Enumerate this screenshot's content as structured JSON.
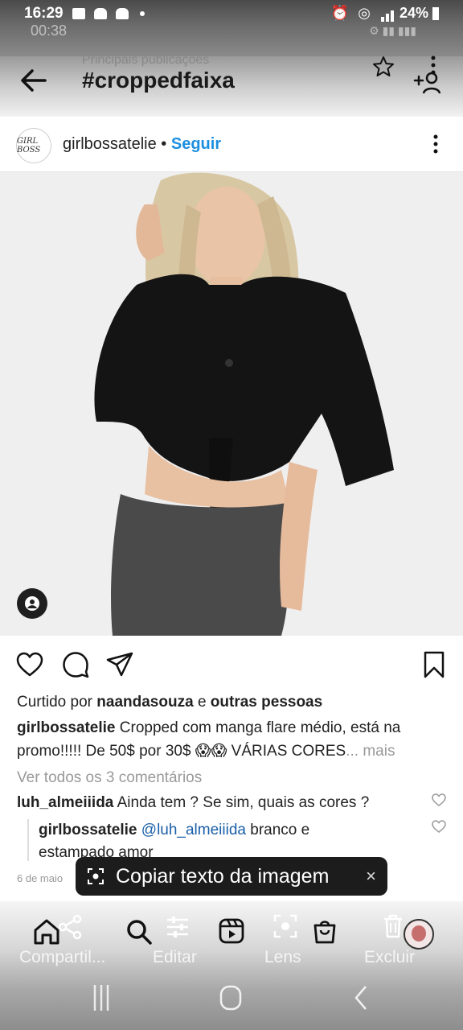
{
  "status": {
    "time": "16:29",
    "time_secondary": "00:38",
    "battery": "24%"
  },
  "header": {
    "subtitle": "Principais publicações",
    "title": "#croppedfaixa"
  },
  "post": {
    "username": "girlbossatelie",
    "separator": "•",
    "follow_label": "Seguir",
    "avatar_text": "GIRL BOSS",
    "liked_by_prefix": "Curtido por",
    "liked_by_user": "naandasouza",
    "liked_by_and": "e",
    "liked_by_others": "outras pessoas",
    "caption_user": "girlbossatelie",
    "caption_line1": "Cropped com manga flare médio, está na",
    "caption_line2": "promo!!!!! De 50$ por 30$ 😱😱 VÁRIAS CORES",
    "caption_more": "... mais",
    "view_comments": "Ver todos os 3 comentários",
    "comments": [
      {
        "user": "luh_almeiiida",
        "text": "Ainda tem ? Se sim, quais as cores ?"
      },
      {
        "user": "girlbossatelie",
        "mention": "@luh_almeiiida",
        "text": "branco e",
        "text2": "estampado amor"
      }
    ],
    "date": "6 de maio"
  },
  "toast": {
    "label": "Copiar texto da imagem",
    "close": "×"
  },
  "toolbar": {
    "share": "Compartil...",
    "edit": "Editar",
    "lens": "Lens",
    "delete": "Excluir"
  },
  "icons": {
    "back": "arrow-left-icon",
    "star": "star-icon",
    "more": "kebab-icon",
    "add_user": "add-user-icon",
    "like": "heart-icon",
    "comment": "comment-icon",
    "share": "paper-plane-icon",
    "save": "bookmark-icon"
  },
  "colors": {
    "accent": "#1d8fe0",
    "toast_bg": "#1c1c1c"
  }
}
